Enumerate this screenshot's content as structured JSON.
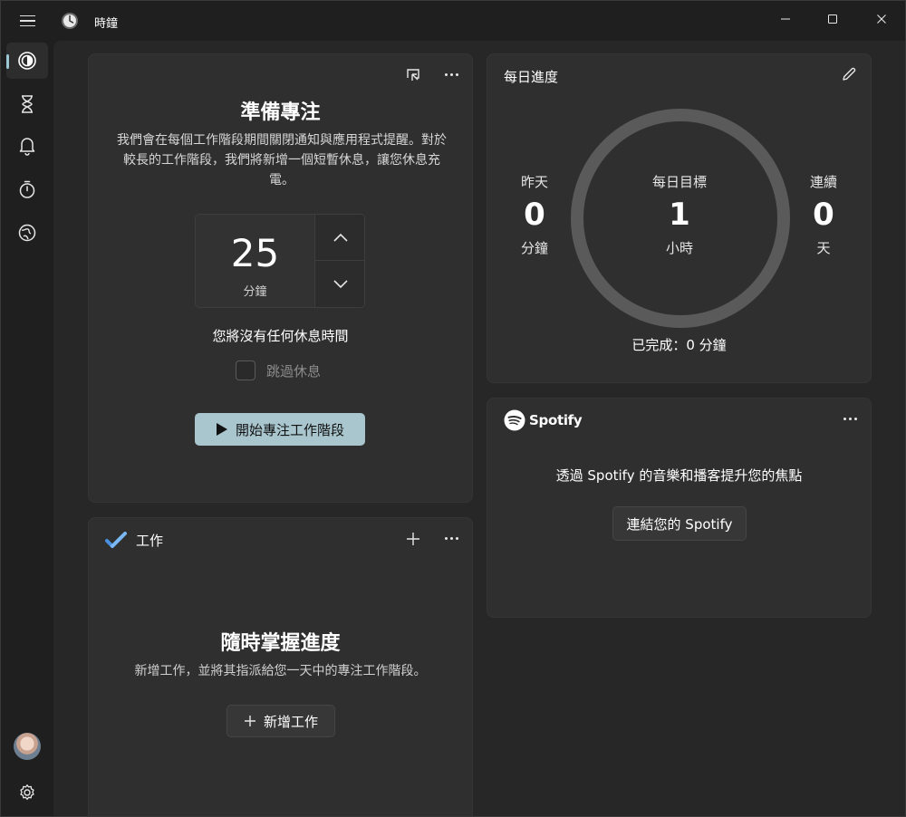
{
  "app": {
    "title": "時鐘"
  },
  "sidebar": {
    "items": [
      {
        "name": "focus-sessions",
        "icon": "focus-icon",
        "active": true
      },
      {
        "name": "timer",
        "icon": "hourglass-icon"
      },
      {
        "name": "alarm",
        "icon": "bell-icon"
      },
      {
        "name": "stopwatch",
        "icon": "stopwatch-icon"
      },
      {
        "name": "world-clock",
        "icon": "globe-icon"
      }
    ]
  },
  "focus": {
    "title": "準備專注",
    "description": "我們會在每個工作階段期間關閉通知與應用程式提醒。對於較長的工作階段，我們將新增一個短暫休息，讓您休息充電。",
    "value": "25",
    "unit": "分鐘",
    "break_text": "您將沒有任何休息時間",
    "skip_label": "跳過休息",
    "start_label": "開始專注工作階段"
  },
  "tasks": {
    "title": "工作",
    "heading": "隨時掌握進度",
    "subtitle": "新增工作，並將其指派給您一天中的專注工作階段。",
    "add_label": "新增工作"
  },
  "daily": {
    "title": "每日進度",
    "yesterday": {
      "label": "昨天",
      "value": "0",
      "unit": "分鐘"
    },
    "goal": {
      "label": "每日目標",
      "value": "1",
      "unit": "小時"
    },
    "streak": {
      "label": "連續",
      "value": "0",
      "unit": "天"
    },
    "completed": "已完成：0 分鐘",
    "progress": 0
  },
  "spotify": {
    "brand": "Spotify",
    "description": "透過 Spotify 的音樂和播客提升您的焦點",
    "connect_label": "連結您的 Spotify"
  },
  "colors": {
    "accent": "#a9c6cf",
    "ring": "#5a5a5a",
    "card": "#2f2f2f",
    "background": "#272727"
  }
}
